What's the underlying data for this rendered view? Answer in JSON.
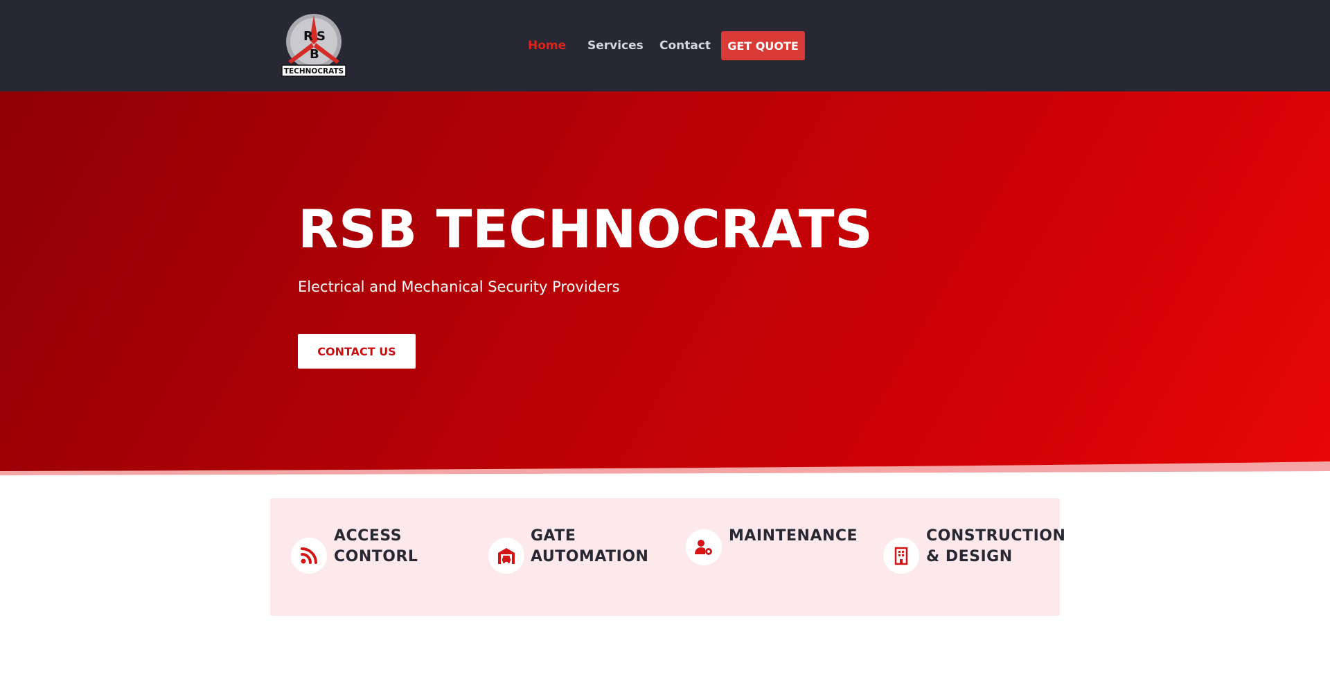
{
  "header": {
    "logo": {
      "letters": [
        "R",
        "S",
        "B"
      ],
      "wordmark": "TECHNOCRATS"
    },
    "nav": [
      {
        "label": "Home",
        "active": true
      },
      {
        "label": "Services",
        "active": false
      },
      {
        "label": "Contact",
        "active": false
      }
    ],
    "cta_label": "GET QUOTE"
  },
  "hero": {
    "title": "RSB TECHNOCRATS",
    "subtitle": "Electrical and Mechanical Security Providers",
    "button_label": "CONTACT US"
  },
  "services": [
    {
      "icon": "rss-icon",
      "label_line1": "ACCESS",
      "label_line2": "CONTORL"
    },
    {
      "icon": "garage-car-icon",
      "label_line1": "GATE",
      "label_line2": "AUTOMATION"
    },
    {
      "icon": "user-gear-icon",
      "label_line1": "MAINTENANCE",
      "label_line2": ""
    },
    {
      "icon": "building-icon",
      "label_line1": "CONSTRUCTION",
      "label_line2": "& DESIGN"
    }
  ],
  "colors": {
    "header_bg": "#272833",
    "accent_red": "#e2231a",
    "quote_button": "#d93a36",
    "services_bg": "#fde9eb"
  }
}
